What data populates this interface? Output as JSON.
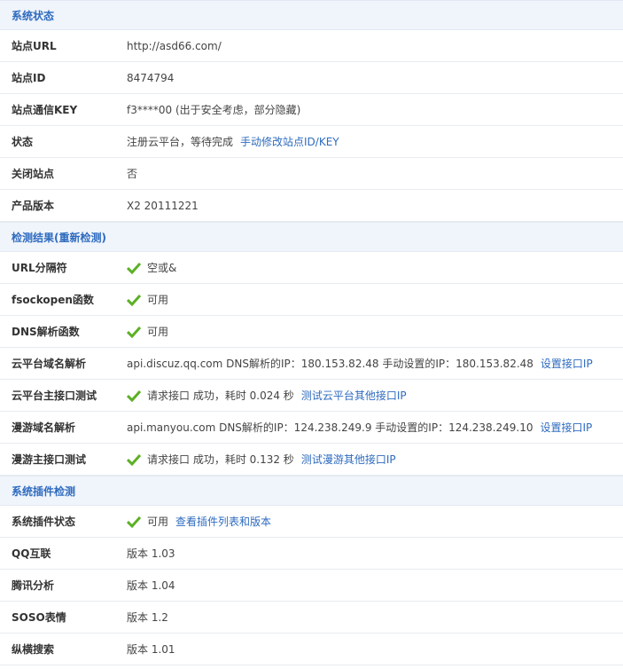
{
  "sections": {
    "status_title": "系统状态",
    "check_title": "检测结果(重新检测)",
    "plugins_title": "系统插件检测"
  },
  "status": {
    "site_url": {
      "label": "站点URL",
      "value": "http://asd66.com/"
    },
    "site_id": {
      "label": "站点ID",
      "value": "8474794"
    },
    "site_key": {
      "label": "站点通信KEY",
      "value": "f3****00 (出于安全考虑，部分隐藏)"
    },
    "state": {
      "label": "状态",
      "value": "注册云平台，等待完成",
      "link": "手动修改站点ID/KEY"
    },
    "close_site": {
      "label": "关闭站点",
      "value": "否"
    },
    "product_version": {
      "label": "产品版本",
      "value": "X2 20111221"
    }
  },
  "check": {
    "url_sep": {
      "label": "URL分隔符",
      "value": "空或&"
    },
    "fsockopen": {
      "label": "fsockopen函数",
      "value": "可用"
    },
    "dns": {
      "label": "DNS解析函数",
      "value": "可用"
    },
    "cloud_domain": {
      "label": "云平台域名解析",
      "value": "api.discuz.qq.com DNS解析的IP：180.153.82.48 手动设置的IP：180.153.82.48",
      "link": "设置接口IP"
    },
    "cloud_main": {
      "label": "云平台主接口测试",
      "value": "请求接口 成功，耗时  0.024 秒",
      "link": "测试云平台其他接口IP"
    },
    "roam_domain": {
      "label": "漫游域名解析",
      "value": "api.manyou.com DNS解析的IP：124.238.249.9 手动设置的IP：124.238.249.10",
      "link": "设置接口IP"
    },
    "roam_main": {
      "label": "漫游主接口测试",
      "value": "请求接口 成功，耗时  0.132 秒",
      "link": "测试漫游其他接口IP"
    }
  },
  "plugins": {
    "plugin_state": {
      "label": "系统插件状态",
      "value": "可用",
      "link": "查看插件列表和版本"
    },
    "qq": {
      "label": "QQ互联",
      "value": "版本  1.03"
    },
    "tencent": {
      "label": "腾讯分析",
      "value": "版本  1.04"
    },
    "soso": {
      "label": "SOSO表情",
      "value": "版本  1.2"
    },
    "zongheng": {
      "label": "纵横搜索",
      "value": "版本  1.01"
    }
  },
  "colors": {
    "link": "#2e6bbf",
    "section_bg": "#f0f4fb",
    "check": "#5cb025"
  },
  "icons": {
    "check": "check-icon"
  }
}
